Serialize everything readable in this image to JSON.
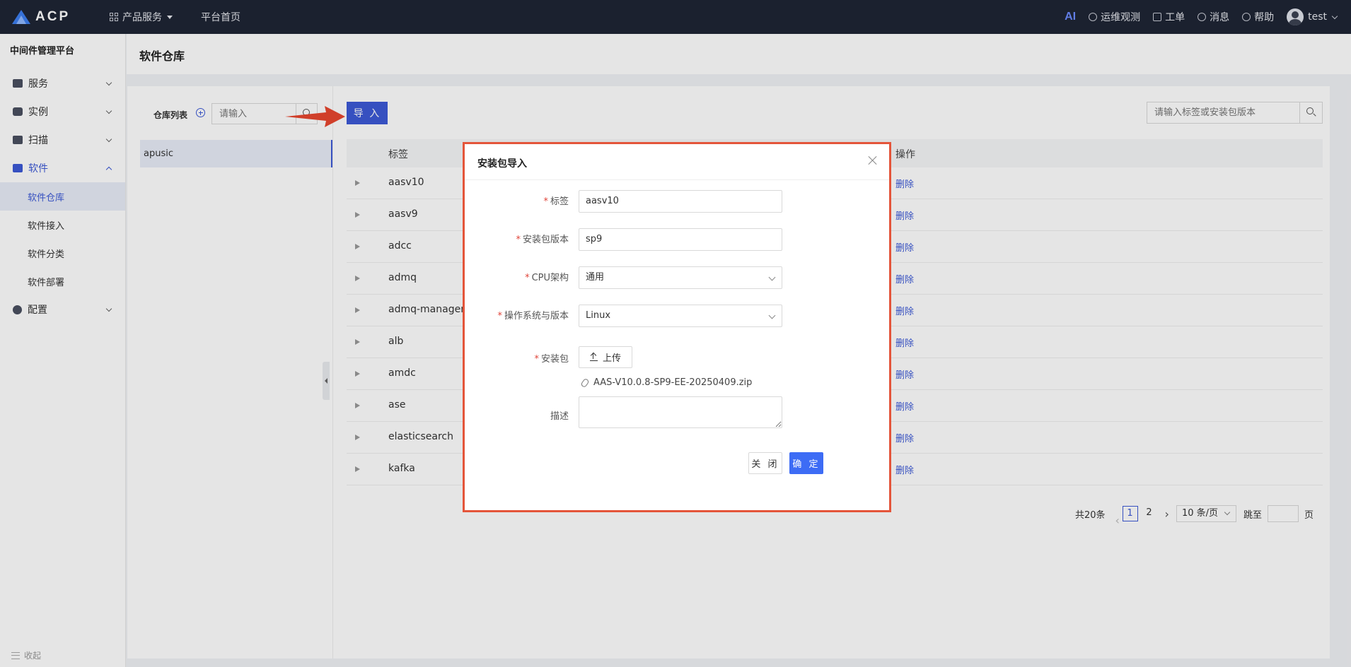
{
  "app": {
    "logo_text": "ACP",
    "nav_products": "产品服务",
    "nav_home": "平台首页",
    "ai": "AI",
    "ops": "运维观测",
    "ticket": "工单",
    "messages": "消息",
    "help": "帮助",
    "user": "test"
  },
  "sidebar": {
    "title": "中间件管理平台",
    "items": [
      {
        "label": "服务"
      },
      {
        "label": "实例"
      },
      {
        "label": "扫描"
      },
      {
        "label": "软件"
      },
      {
        "label": "配置"
      }
    ],
    "software_sub": [
      "软件仓库",
      "软件接入",
      "软件分类",
      "软件部署"
    ],
    "collapse": "收起"
  },
  "page": {
    "title": "软件仓库",
    "repo_list_label": "仓库列表",
    "repo_search_placeholder": "请输入",
    "repo_items": [
      "apusic"
    ],
    "import_button": "导 入",
    "search_placeholder": "请输入标签或安装包版本"
  },
  "table": {
    "col_tag": "标签",
    "col_op": "操作",
    "delete_label": "删除",
    "rows": [
      "aasv10",
      "aasv9",
      "adcc",
      "admq",
      "admq-manager",
      "alb",
      "amdc",
      "ase",
      "elasticsearch",
      "kafka"
    ]
  },
  "pagination": {
    "total": "共20条",
    "pages": [
      "1",
      "2"
    ],
    "current": "1",
    "page_size": "10 条/页",
    "jump_label": "跳至",
    "page_suffix": "页"
  },
  "modal": {
    "title": "安装包导入",
    "fields": {
      "tag_label": "标签",
      "tag_value": "aasv10",
      "version_label": "安装包版本",
      "version_value": "sp9",
      "cpu_label": "CPU架构",
      "cpu_value": "通用",
      "os_label": "操作系统与版本",
      "os_value": "Linux",
      "package_label": "安装包",
      "upload_button": "上传",
      "file_name": "AAS-V10.0.8-SP9-EE-20250409.zip",
      "desc_label": "描述"
    },
    "close_button": "关 闭",
    "confirm_button": "确 定"
  },
  "colors": {
    "topbar": "#1f2535",
    "accent": "#3d5ad6",
    "highlight_border": "#e4553a"
  }
}
